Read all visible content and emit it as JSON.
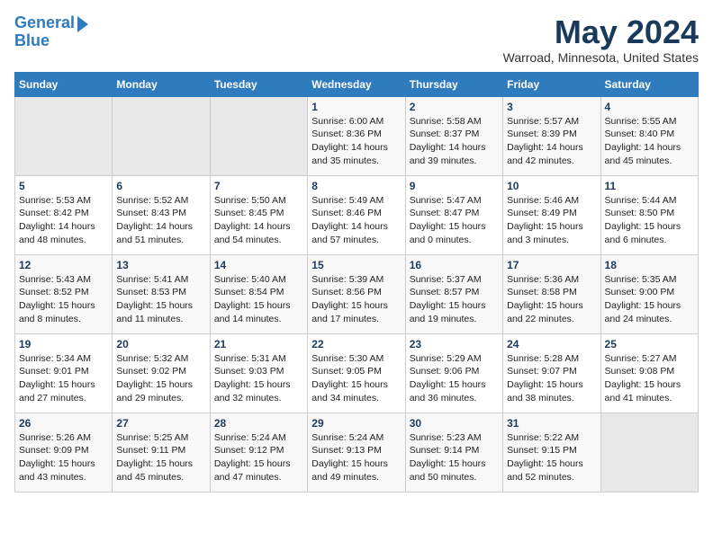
{
  "logo": {
    "line1": "General",
    "line2": "Blue"
  },
  "title": "May 2024",
  "location": "Warroad, Minnesota, United States",
  "weekdays": [
    "Sunday",
    "Monday",
    "Tuesday",
    "Wednesday",
    "Thursday",
    "Friday",
    "Saturday"
  ],
  "weeks": [
    [
      {
        "day": "",
        "info": ""
      },
      {
        "day": "",
        "info": ""
      },
      {
        "day": "",
        "info": ""
      },
      {
        "day": "1",
        "info": "Sunrise: 6:00 AM\nSunset: 8:36 PM\nDaylight: 14 hours\nand 35 minutes."
      },
      {
        "day": "2",
        "info": "Sunrise: 5:58 AM\nSunset: 8:37 PM\nDaylight: 14 hours\nand 39 minutes."
      },
      {
        "day": "3",
        "info": "Sunrise: 5:57 AM\nSunset: 8:39 PM\nDaylight: 14 hours\nand 42 minutes."
      },
      {
        "day": "4",
        "info": "Sunrise: 5:55 AM\nSunset: 8:40 PM\nDaylight: 14 hours\nand 45 minutes."
      }
    ],
    [
      {
        "day": "5",
        "info": "Sunrise: 5:53 AM\nSunset: 8:42 PM\nDaylight: 14 hours\nand 48 minutes."
      },
      {
        "day": "6",
        "info": "Sunrise: 5:52 AM\nSunset: 8:43 PM\nDaylight: 14 hours\nand 51 minutes."
      },
      {
        "day": "7",
        "info": "Sunrise: 5:50 AM\nSunset: 8:45 PM\nDaylight: 14 hours\nand 54 minutes."
      },
      {
        "day": "8",
        "info": "Sunrise: 5:49 AM\nSunset: 8:46 PM\nDaylight: 14 hours\nand 57 minutes."
      },
      {
        "day": "9",
        "info": "Sunrise: 5:47 AM\nSunset: 8:47 PM\nDaylight: 15 hours\nand 0 minutes."
      },
      {
        "day": "10",
        "info": "Sunrise: 5:46 AM\nSunset: 8:49 PM\nDaylight: 15 hours\nand 3 minutes."
      },
      {
        "day": "11",
        "info": "Sunrise: 5:44 AM\nSunset: 8:50 PM\nDaylight: 15 hours\nand 6 minutes."
      }
    ],
    [
      {
        "day": "12",
        "info": "Sunrise: 5:43 AM\nSunset: 8:52 PM\nDaylight: 15 hours\nand 8 minutes."
      },
      {
        "day": "13",
        "info": "Sunrise: 5:41 AM\nSunset: 8:53 PM\nDaylight: 15 hours\nand 11 minutes."
      },
      {
        "day": "14",
        "info": "Sunrise: 5:40 AM\nSunset: 8:54 PM\nDaylight: 15 hours\nand 14 minutes."
      },
      {
        "day": "15",
        "info": "Sunrise: 5:39 AM\nSunset: 8:56 PM\nDaylight: 15 hours\nand 17 minutes."
      },
      {
        "day": "16",
        "info": "Sunrise: 5:37 AM\nSunset: 8:57 PM\nDaylight: 15 hours\nand 19 minutes."
      },
      {
        "day": "17",
        "info": "Sunrise: 5:36 AM\nSunset: 8:58 PM\nDaylight: 15 hours\nand 22 minutes."
      },
      {
        "day": "18",
        "info": "Sunrise: 5:35 AM\nSunset: 9:00 PM\nDaylight: 15 hours\nand 24 minutes."
      }
    ],
    [
      {
        "day": "19",
        "info": "Sunrise: 5:34 AM\nSunset: 9:01 PM\nDaylight: 15 hours\nand 27 minutes."
      },
      {
        "day": "20",
        "info": "Sunrise: 5:32 AM\nSunset: 9:02 PM\nDaylight: 15 hours\nand 29 minutes."
      },
      {
        "day": "21",
        "info": "Sunrise: 5:31 AM\nSunset: 9:03 PM\nDaylight: 15 hours\nand 32 minutes."
      },
      {
        "day": "22",
        "info": "Sunrise: 5:30 AM\nSunset: 9:05 PM\nDaylight: 15 hours\nand 34 minutes."
      },
      {
        "day": "23",
        "info": "Sunrise: 5:29 AM\nSunset: 9:06 PM\nDaylight: 15 hours\nand 36 minutes."
      },
      {
        "day": "24",
        "info": "Sunrise: 5:28 AM\nSunset: 9:07 PM\nDaylight: 15 hours\nand 38 minutes."
      },
      {
        "day": "25",
        "info": "Sunrise: 5:27 AM\nSunset: 9:08 PM\nDaylight: 15 hours\nand 41 minutes."
      }
    ],
    [
      {
        "day": "26",
        "info": "Sunrise: 5:26 AM\nSunset: 9:09 PM\nDaylight: 15 hours\nand 43 minutes."
      },
      {
        "day": "27",
        "info": "Sunrise: 5:25 AM\nSunset: 9:11 PM\nDaylight: 15 hours\nand 45 minutes."
      },
      {
        "day": "28",
        "info": "Sunrise: 5:24 AM\nSunset: 9:12 PM\nDaylight: 15 hours\nand 47 minutes."
      },
      {
        "day": "29",
        "info": "Sunrise: 5:24 AM\nSunset: 9:13 PM\nDaylight: 15 hours\nand 49 minutes."
      },
      {
        "day": "30",
        "info": "Sunrise: 5:23 AM\nSunset: 9:14 PM\nDaylight: 15 hours\nand 50 minutes."
      },
      {
        "day": "31",
        "info": "Sunrise: 5:22 AM\nSunset: 9:15 PM\nDaylight: 15 hours\nand 52 minutes."
      },
      {
        "day": "",
        "info": ""
      }
    ]
  ]
}
